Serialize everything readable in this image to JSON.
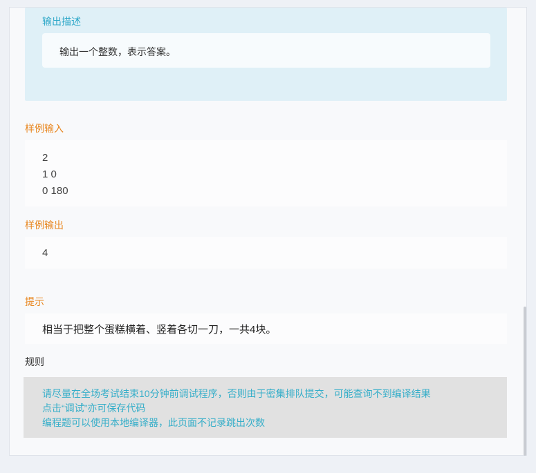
{
  "output_description": {
    "title": "输出描述",
    "text": "输出一个整数，表示答案。"
  },
  "sample_input": {
    "title": "样例输入",
    "lines": [
      "2",
      "1 0",
      "0 180"
    ]
  },
  "sample_output": {
    "title": "样例输出",
    "lines": [
      "4"
    ]
  },
  "hint": {
    "title": "提示",
    "text": "相当于把整个蛋糕横着、竖着各切一刀，一共4块。"
  },
  "rules": {
    "title": "规则",
    "lines": [
      "请尽量在全场考试结束10分钟前调试程序，否则由于密集排队提交，可能查询不到编译结果",
      "点击“调试”亦可保存代码",
      "编程题可以使用本地编译器，此页面不记录跳出次数"
    ]
  },
  "colors": {
    "section_title": "#e8861f",
    "accent_blue": "#2ca7c8",
    "rules_text": "#36aec9"
  }
}
